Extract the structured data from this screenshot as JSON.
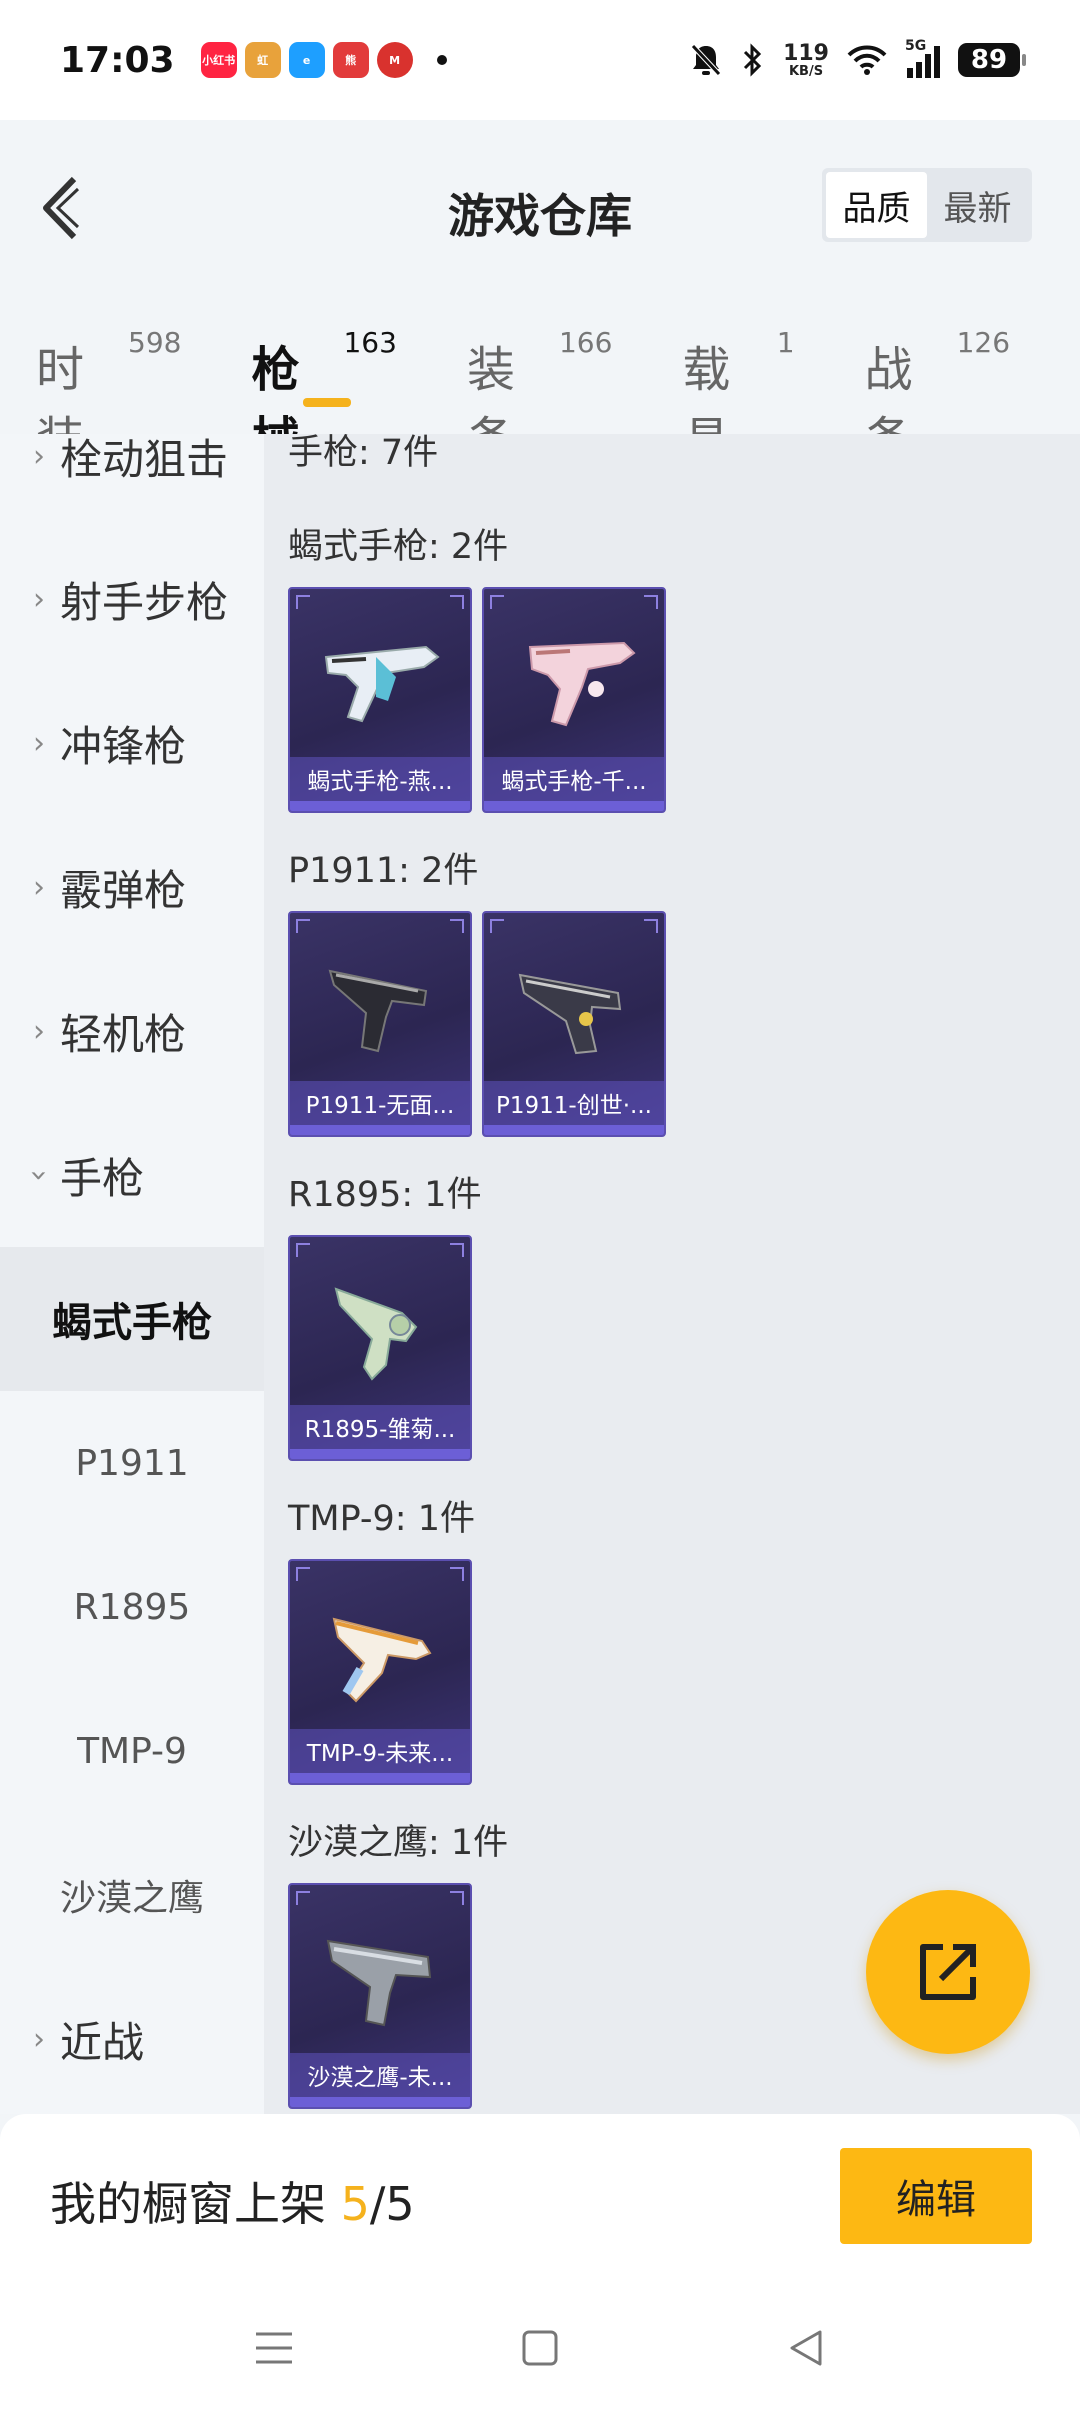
{
  "status_bar": {
    "time": "17:03",
    "notif_icons": [
      {
        "name": "xiaohongshu-icon",
        "text": "小红书",
        "color": "#ff2442"
      },
      {
        "name": "app-icon-2",
        "text": "虹",
        "color": "#e8a23b"
      },
      {
        "name": "app-icon-3",
        "text": "e",
        "color": "#1e9fff"
      },
      {
        "name": "app-icon-4",
        "text": "熊",
        "color": "#e23b3b"
      },
      {
        "name": "app-icon-5",
        "text": "M",
        "color": "#d9322e"
      }
    ],
    "net_speed": "119",
    "net_unit": "KB/S",
    "network": "5G",
    "battery": "89"
  },
  "header": {
    "title": "游戏仓库",
    "sort_options": [
      "品质",
      "最新"
    ]
  },
  "tabs": [
    {
      "label": "时装",
      "count": "598"
    },
    {
      "label": "枪械",
      "count": "163"
    },
    {
      "label": "装备",
      "count": "166"
    },
    {
      "label": "载具",
      "count": "1"
    },
    {
      "label": "战备",
      "count": "126"
    }
  ],
  "sidebar": {
    "categories": [
      {
        "label": "栓动狙击"
      },
      {
        "label": "射手步枪"
      },
      {
        "label": "冲锋枪"
      },
      {
        "label": "霰弹枪"
      },
      {
        "label": "轻机枪"
      },
      {
        "label": "手枪"
      }
    ],
    "subitems": [
      {
        "label": "蝎式手枪"
      },
      {
        "label": "P1911"
      },
      {
        "label": "R1895"
      },
      {
        "label": "TMP-9"
      },
      {
        "label": "沙漠之鹰"
      }
    ],
    "last_category": {
      "label": "近战"
    }
  },
  "content": {
    "partial_header": "手枪: 7件",
    "groups": [
      {
        "title": "蝎式手枪: 2件",
        "items": [
          {
            "label": "蝎式手枪-燕..."
          },
          {
            "label": "蝎式手枪-千..."
          }
        ]
      },
      {
        "title": "P1911: 2件",
        "items": [
          {
            "label": "P1911-无面..."
          },
          {
            "label": "P1911-创世·..."
          }
        ]
      },
      {
        "title": "R1895: 1件",
        "items": [
          {
            "label": "R1895-雏菊..."
          }
        ]
      },
      {
        "title": "TMP-9: 1件",
        "items": [
          {
            "label": "TMP-9-未来..."
          }
        ]
      },
      {
        "title": "沙漠之鹰: 1件",
        "items": [
          {
            "label": "沙漠之鹰-未..."
          }
        ]
      }
    ]
  },
  "bottom": {
    "shelf_label": "我的橱窗上架 ",
    "shelf_current": "5",
    "shelf_total": "/5",
    "edit_label": "编辑"
  },
  "colors": {
    "accent": "#fdb813",
    "card_bg": "#2c2652",
    "card_border": "#5b4fb0"
  }
}
